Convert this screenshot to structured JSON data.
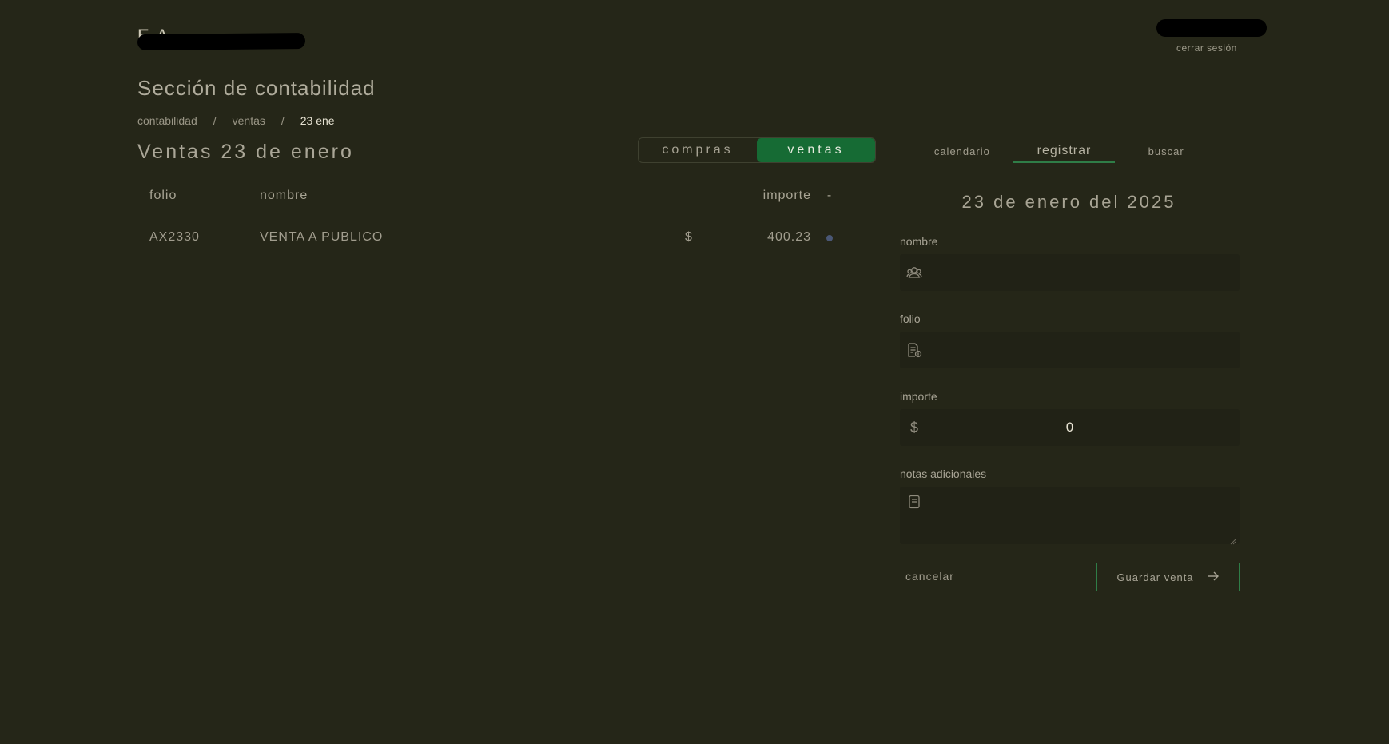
{
  "header": {
    "brand": "E     A",
    "logout_label": "cerrar sesión"
  },
  "section_title": "Sección de contabilidad",
  "breadcrumb": {
    "items": [
      "contabilidad",
      "ventas",
      "23 ene"
    ],
    "separator": "/"
  },
  "page_title": "Ventas 23 de enero",
  "toggle": {
    "options": [
      "compras",
      "ventas"
    ],
    "selected": "ventas"
  },
  "tabs": {
    "items": [
      "calendario",
      "registrar",
      "buscar"
    ],
    "active": "registrar"
  },
  "table": {
    "headers": {
      "folio": "folio",
      "nombre": "nombre",
      "importe": "importe",
      "actions": "-"
    },
    "rows": [
      {
        "folio": "AX2330",
        "nombre": "VENTA A PUBLICO",
        "currency": "$",
        "importe": "400.23",
        "status_color": "#4a5775"
      }
    ]
  },
  "form": {
    "date_heading": "23 de enero del 2025",
    "nombre_label": "nombre",
    "nombre_icon": "users-icon",
    "folio_label": "folio",
    "folio_icon": "document-icon",
    "importe_label": "importe",
    "importe_currency": "$",
    "importe_value": "0",
    "notas_label": "notas adicionales",
    "notas_icon": "note-icon",
    "cancel_label": "cancelar",
    "save_label": "Guardar venta"
  },
  "colors": {
    "background": "#252618",
    "accent": "#166b34",
    "accent_border": "#2f7d47"
  }
}
